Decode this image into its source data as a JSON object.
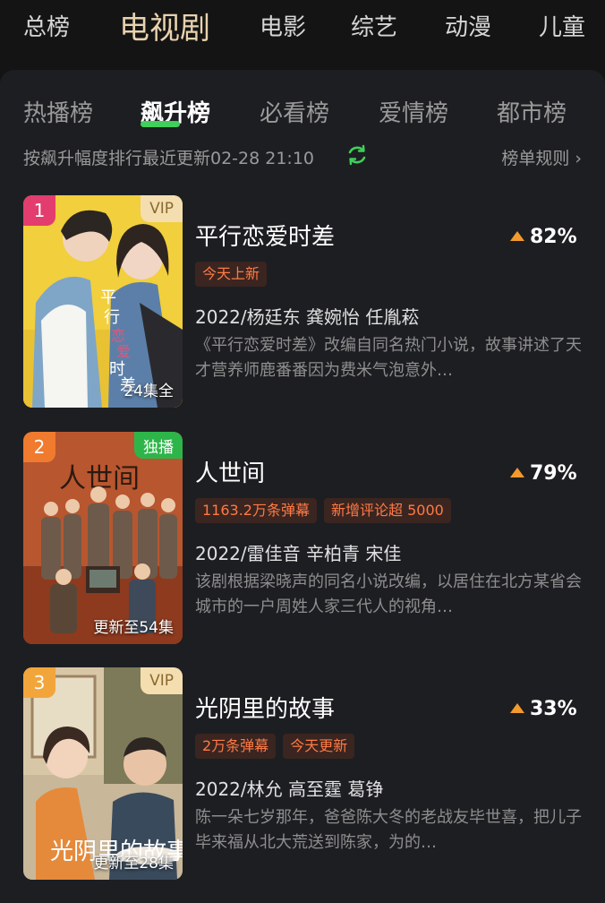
{
  "top_tabs": [
    "总榜",
    "电视剧",
    "电影",
    "综艺",
    "动漫",
    "儿童"
  ],
  "active_top_tab": "电视剧",
  "sub_tabs": [
    "热播榜",
    "飙升榜",
    "必看榜",
    "爱情榜",
    "都市榜"
  ],
  "active_sub_tab": "飙升榜",
  "info": {
    "description": "按飙升幅度排行最近更新02-28 21:10",
    "rules_label": "榜单规则",
    "refresh_icon": "refresh-icon",
    "chevron_icon": "chevron-right-icon"
  },
  "colors": {
    "accent_green": "#3fcf5a",
    "rise_orange": "#f29a2e",
    "badge_text": "#ff7a45"
  },
  "items": [
    {
      "rank": "1",
      "rank_color": "#e23d6e",
      "tag": "VIP",
      "episodes": "24集全",
      "title": "平行恋爱时差",
      "rise": "82%",
      "badges": [
        "今天上新"
      ],
      "meta": "2022/杨廷东 龚婉怡 任胤菘",
      "summary": "《平行恋爱时差》改编自同名热门小说，故事讲述了天才营养师鹿番番因为费米气泡意外…"
    },
    {
      "rank": "2",
      "rank_color": "#f07a2e",
      "tag": "独播",
      "episodes": "更新至54集",
      "title": "人世间",
      "rise": "79%",
      "badges": [
        "1163.2万条弹幕",
        "新增评论超 5000"
      ],
      "meta": "2022/雷佳音 辛柏青 宋佳",
      "summary": "该剧根据梁晓声的同名小说改编，以居住在北方某省会城市的一户周姓人家三代人的视角…"
    },
    {
      "rank": "3",
      "rank_color": "#f2a53a",
      "tag": "VIP",
      "episodes": "更新至28集",
      "title": "光阴里的故事",
      "rise": "33%",
      "badges": [
        "2万条弹幕",
        "今天更新"
      ],
      "meta": "2022/林允 高至霆 葛铮",
      "summary": "陈一朵七岁那年，爸爸陈大冬的老战友毕世喜，把儿子毕来福从北大荒送到陈家，为的…"
    }
  ]
}
